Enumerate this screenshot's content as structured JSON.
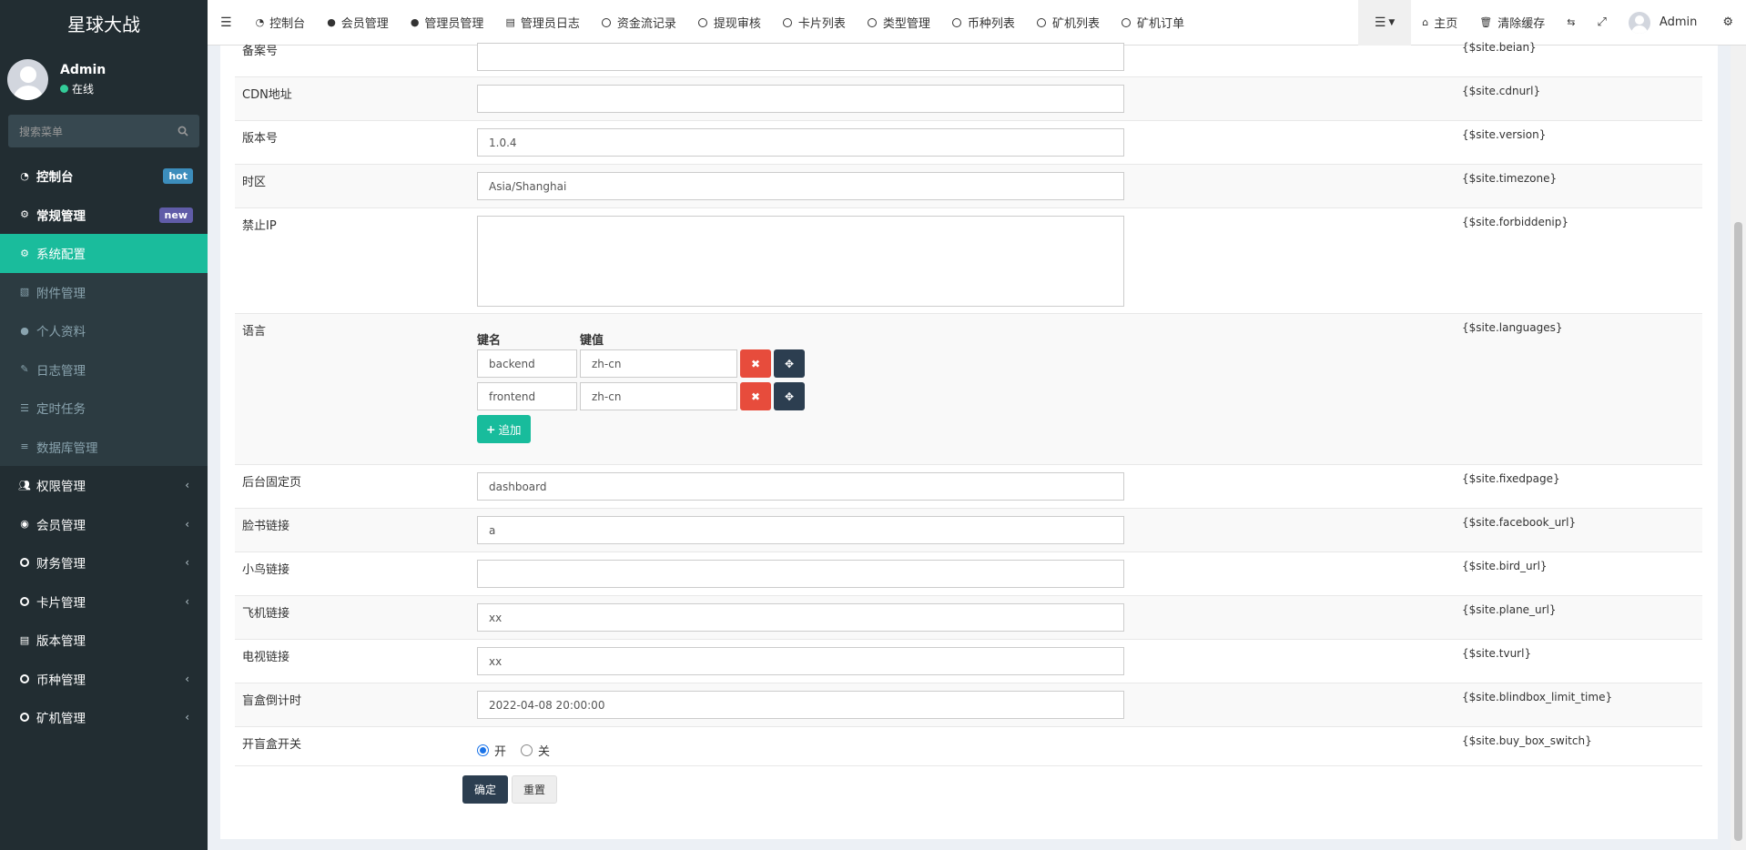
{
  "app": {
    "title": "星球大战"
  },
  "user": {
    "name": "Admin",
    "status": "在线"
  },
  "search": {
    "placeholder": "搜索菜单"
  },
  "sidebar": {
    "items": [
      {
        "label": "控制台",
        "badge": "hot",
        "badge_color": "#3c8dbc"
      },
      {
        "label": "常规管理",
        "badge": "new",
        "badge_color": "#605ca8"
      },
      {
        "label": "系统配置"
      },
      {
        "label": "附件管理"
      },
      {
        "label": "个人资料"
      },
      {
        "label": "日志管理"
      },
      {
        "label": "定时任务"
      },
      {
        "label": "数据库管理"
      },
      {
        "label": "权限管理"
      },
      {
        "label": "会员管理"
      },
      {
        "label": "财务管理"
      },
      {
        "label": "卡片管理"
      },
      {
        "label": "版本管理"
      },
      {
        "label": "币种管理"
      },
      {
        "label": "矿机管理"
      }
    ]
  },
  "topnav": {
    "tabs": [
      "控制台",
      "会员管理",
      "管理员管理",
      "管理员日志",
      "资金流记录",
      "提现审核",
      "卡片列表",
      "类型管理",
      "币种列表",
      "矿机列表",
      "矿机订单"
    ],
    "home": "主页",
    "clear_cache": "清除缓存",
    "admin": "Admin"
  },
  "form": {
    "rows": [
      {
        "label": "备案号",
        "value": "",
        "var": "{$site.beian}"
      },
      {
        "label": "CDN地址",
        "value": "",
        "var": "{$site.cdnurl}"
      },
      {
        "label": "版本号",
        "value": "1.0.4",
        "var": "{$site.version}"
      },
      {
        "label": "时区",
        "value": "Asia/Shanghai",
        "var": "{$site.timezone}"
      },
      {
        "label": "禁止IP",
        "value": "",
        "var": "{$site.forbiddenip}"
      },
      {
        "label": "语言",
        "var": "{$site.languages}"
      },
      {
        "label": "后台固定页",
        "value": "dashboard",
        "var": "{$site.fixedpage}"
      },
      {
        "label": "脸书链接",
        "value": "a",
        "var": "{$site.facebook_url}"
      },
      {
        "label": "小鸟链接",
        "value": "",
        "var": "{$site.bird_url}"
      },
      {
        "label": "飞机链接",
        "value": "xx",
        "var": "{$site.plane_url}"
      },
      {
        "label": "电视链接",
        "value": "xx",
        "var": "{$site.tvurl}"
      },
      {
        "label": "盲盒倒计时",
        "value": "2022-04-08 20:00:00",
        "var": "{$site.blindbox_limit_time}"
      },
      {
        "label": "开盲盒开关",
        "var": "{$site.buy_box_switch}"
      }
    ],
    "languages": {
      "key_header": "键名",
      "value_header": "键值",
      "items": [
        {
          "key": "backend",
          "value": "zh-cn"
        },
        {
          "key": "frontend",
          "value": "zh-cn"
        }
      ],
      "add_label": "追加"
    },
    "switch": {
      "on_label": "开",
      "off_label": "关",
      "selected": "开"
    },
    "submit_label": "确定",
    "reset_label": "重置"
  }
}
